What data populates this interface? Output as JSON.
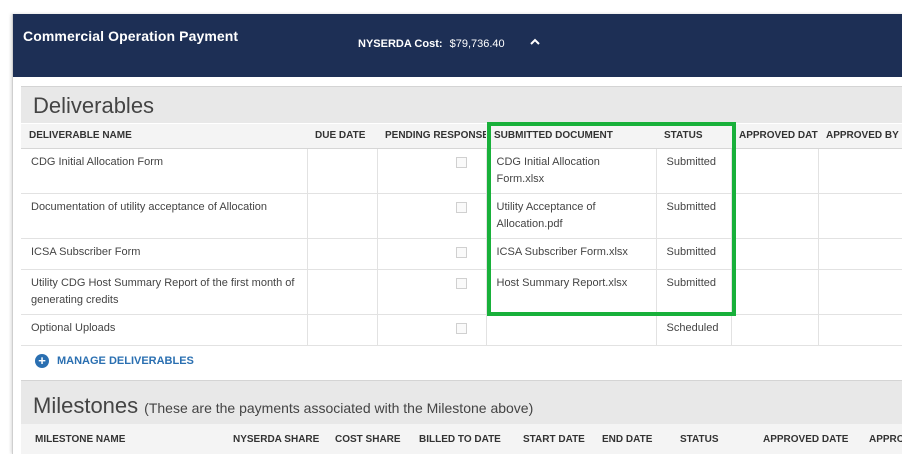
{
  "header": {
    "title": "Commercial Operation Payment",
    "cost_label": "NYSERDA Cost:",
    "cost_value": "$79,736.40",
    "background": "#1d2f55"
  },
  "deliverables": {
    "heading": "Deliverables",
    "columns": [
      "DELIVERABLE NAME",
      "DUE DATE",
      "PENDING RESPONSE",
      "SUBMITTED DOCUMENT",
      "STATUS",
      "APPROVED DATE",
      "APPROVED BY"
    ],
    "rows": [
      {
        "name": "CDG Initial Allocation Form",
        "due": "",
        "document": "CDG Initial Allocation Form.xlsx",
        "status": "Submitted",
        "approved_date": "",
        "approved_by": ""
      },
      {
        "name": "Documentation of utility acceptance of Allocation",
        "due": "",
        "document": "Utility Acceptance of Allocation.pdf",
        "status": "Submitted",
        "approved_date": "",
        "approved_by": ""
      },
      {
        "name": "ICSA Subscriber Form",
        "due": "",
        "document": "ICSA Subscriber Form.xlsx",
        "status": "Submitted",
        "approved_date": "",
        "approved_by": ""
      },
      {
        "name": "Utility CDG Host Summary Report of the first month of generating credits",
        "due": "",
        "document": "Host Summary Report.xlsx",
        "status": "Submitted",
        "approved_date": "",
        "approved_by": ""
      },
      {
        "name": "Optional Uploads",
        "due": "",
        "document": "",
        "status": "Scheduled",
        "approved_date": "",
        "approved_by": ""
      }
    ],
    "manage_label": "MANAGE DELIVERABLES",
    "highlight_color": "#18b03a"
  },
  "milestones": {
    "heading": "Milestones",
    "subheading": "(These are the payments associated with the Milestone above)",
    "columns": [
      "MILESTONE NAME",
      "NYSERDA SHARE",
      "COST SHARE",
      "BILLED TO DATE",
      "START DATE",
      "END DATE",
      "STATUS",
      "APPROVED DATE",
      "APPROVED BY"
    ]
  }
}
